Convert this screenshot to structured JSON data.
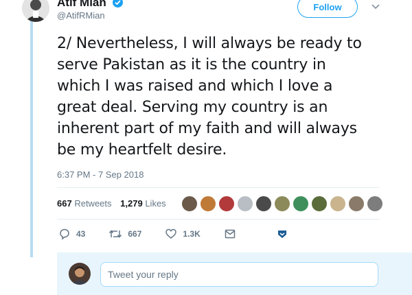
{
  "tweet": {
    "author_name": "Atif Mian",
    "author_handle": "@AtifRMian",
    "follow_label": "Follow",
    "text_lines": [
      "2/ Nevertheless, I will always be ready to",
      "serve Pakistan as it is the country in",
      "which I was raised and which I love a",
      "great deal. Serving my country is an",
      "inherent part of my faith and will always",
      "be my heartfelt desire."
    ],
    "timestamp": "6:37 PM - 7 Sep 2018"
  },
  "stats": {
    "retweets_count": "667",
    "retweets_label": "Retweets",
    "likes_count": "1,279",
    "likes_label": "Likes"
  },
  "likers": [
    {
      "icon": "liker-avatar",
      "color": "#6b5a4a"
    },
    {
      "icon": "liker-avatar",
      "color": "#c07a38"
    },
    {
      "icon": "liker-avatar",
      "color": "#b23a3a"
    },
    {
      "icon": "liker-avatar",
      "color": "#b8bec4"
    },
    {
      "icon": "liker-avatar",
      "color": "#4a4a4a"
    },
    {
      "icon": "liker-avatar",
      "color": "#8c8a5a"
    },
    {
      "icon": "liker-avatar",
      "color": "#3f8f5c"
    },
    {
      "icon": "liker-avatar",
      "color": "#5a6c3a"
    },
    {
      "icon": "liker-avatar",
      "color": "#c9b48e"
    },
    {
      "icon": "liker-avatar",
      "color": "#8a7a6a"
    },
    {
      "icon": "liker-avatar",
      "color": "#7d7d7d"
    }
  ],
  "actions": {
    "reply_count": "43",
    "retweet_count": "667",
    "like_count": "1.3K",
    "icons": [
      "reply-icon",
      "retweet-icon",
      "like-icon",
      "direct-message-icon",
      "bookmark-icon"
    ]
  },
  "reply": {
    "placeholder": "Tweet your reply"
  },
  "colors": {
    "accent": "#1da1f2",
    "thread_line": "#b8dcf3",
    "reply_bg": "#e8f5fd",
    "muted_text": "#657786"
  }
}
